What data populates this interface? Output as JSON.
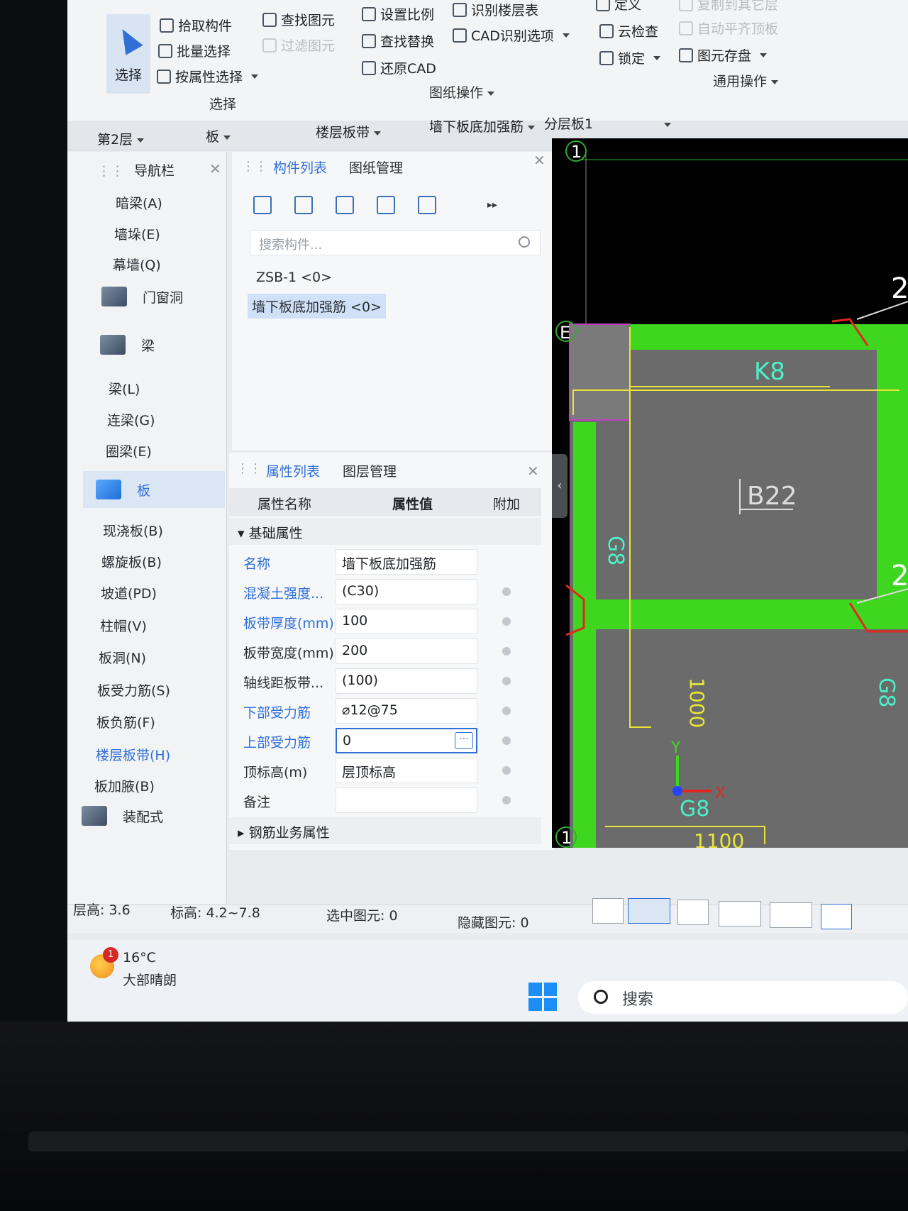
{
  "ribbon": {
    "select_label": "选择",
    "pick_component": "拾取构件",
    "batch_select": "批量选择",
    "select_by_attr": "按属性选择",
    "select_group": "选择",
    "find_element": "查找图元",
    "filter_element": "过滤图元",
    "set_scale": "设置比例",
    "find_replace": "查找替换",
    "restore_cad": "还原CAD",
    "identify_floor_table": "识别楼层表",
    "cad_identify_options": "CAD识别选项",
    "drawing_ops_group": "图纸操作",
    "define": "定义",
    "cloud_check": "云检查",
    "lock": "锁定",
    "copy_to_floor": "复制到其它层",
    "auto_align_top": "自动平齐顶板",
    "element_save": "图元存盘",
    "common_ops_group": "通用操作"
  },
  "strip": {
    "floor": "第2层",
    "category": "板",
    "subcategory": "楼层板带",
    "component": "墙下板底加强筋",
    "layer": "分层板1"
  },
  "nav": {
    "title": "导航栏",
    "items_top": [
      "暗梁(A)",
      "墙垛(E)",
      "幕墙(Q)"
    ],
    "cat_door": "门窗洞",
    "cat_beam": "梁",
    "beam_items": [
      "梁(L)",
      "连梁(G)",
      "圈梁(E)"
    ],
    "cat_slab": "板",
    "slab_items": [
      "现浇板(B)",
      "螺旋板(B)",
      "坡道(PD)",
      "柱帽(V)",
      "板洞(N)",
      "板受力筋(S)",
      "板负筋(F)",
      "楼层板带(H)",
      "板加腋(B)"
    ],
    "cat_next": "装配式"
  },
  "complist": {
    "tab_components": "构件列表",
    "tab_drawings": "图纸管理",
    "search_placeholder": "搜索构件...",
    "items": [
      "ZSB-1 <0>",
      "墙下板底加强筋 <0>"
    ]
  },
  "props": {
    "tab_attrs": "属性列表",
    "tab_layers": "图层管理",
    "col_name": "属性名称",
    "col_value": "属性值",
    "col_extra": "附加",
    "section_basic": "基础属性",
    "section_rebar": "钢筋业务属性",
    "rows": [
      {
        "label": "名称",
        "value": "墙下板底加强筋"
      },
      {
        "label": "混凝土强度...",
        "value": "(C30)"
      },
      {
        "label": "板带厚度(mm)",
        "value": "100"
      },
      {
        "label": "板带宽度(mm)",
        "value": "200"
      },
      {
        "label": "轴线距板带...",
        "value": "(100)"
      },
      {
        "label": "下部受力筋",
        "value": "⌀12@75"
      },
      {
        "label": "上部受力筋",
        "value": "0"
      },
      {
        "label": "顶标高(m)",
        "value": "层顶标高"
      },
      {
        "label": "备注",
        "value": ""
      }
    ],
    "more_btn": "···"
  },
  "canvas": {
    "axis_1_top": "1",
    "axis_e": "E",
    "axis_1_bottom": "1",
    "label_k8": "K8",
    "label_b22": "B22",
    "label_g8_left": "G8",
    "label_g8_bottom": "G8",
    "label_g8_right": "G8",
    "dim_1000": "1000",
    "dim_1100": "1100",
    "num_2_top": "2",
    "num_2_mid": "2",
    "axis_x": "X",
    "axis_y": "Y"
  },
  "status": {
    "floor_height": "层高: 3.6",
    "elevation": "标高: 4.2~7.8",
    "selected": "选中图元: 0",
    "hidden": "隐藏图元: 0"
  },
  "taskbar": {
    "badge": "1",
    "temp": "16°C",
    "weather": "大部晴朗",
    "search": "搜索"
  },
  "colors": {
    "accent": "#2f6fd6",
    "cad_green": "#3fd61f",
    "cad_yellow": "#e8e43a",
    "cad_red": "#e0281e",
    "cad_gray": "#6b6b6b"
  }
}
